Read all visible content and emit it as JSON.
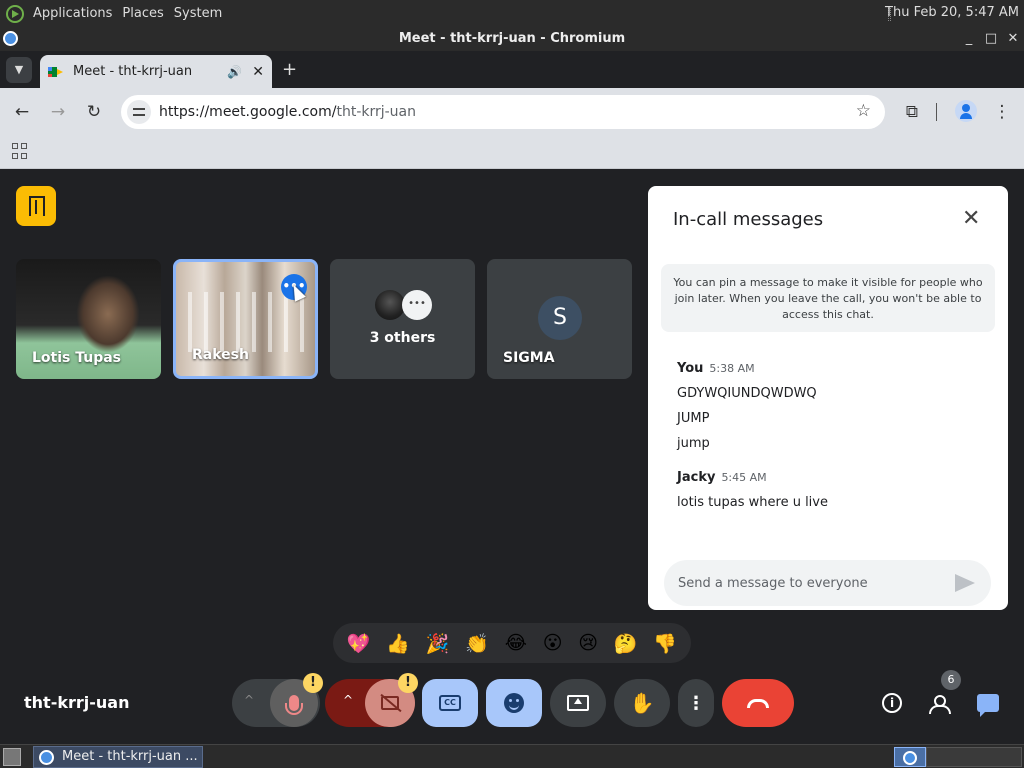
{
  "system_panel": {
    "menus": [
      "Applications",
      "Places",
      "System"
    ],
    "clock": "Thu Feb 20,  5:47 AM"
  },
  "window": {
    "title": "Meet - tht-krrj-uan - Chromium",
    "controls": [
      "_",
      "□",
      "✕"
    ]
  },
  "browser": {
    "tab_title": "Meet - tht-krrj-uan",
    "url_host": "https://meet.google.com/",
    "url_path": "tht-krrj-uan",
    "icons": [
      "back-icon",
      "forward-icon",
      "reload-icon",
      "star-icon",
      "extensions-icon",
      "profile-icon",
      "menu-icon",
      "apps-icon"
    ]
  },
  "meet": {
    "meeting_code": "tht-krrj-uan",
    "tiles": [
      {
        "name": "Lotis Tupas"
      },
      {
        "name": "Rakesh"
      },
      {
        "name": "3 others",
        "avatar_text": "•••"
      },
      {
        "name": "SIGMA",
        "avatar": "S"
      }
    ],
    "reactions": [
      "💖",
      "👍",
      "🎉",
      "👏",
      "😂",
      "😮",
      "😢",
      "🤔",
      "👎"
    ],
    "people_count": "6",
    "warning_glyph": "!",
    "cc_label": "CC"
  },
  "chat": {
    "title": "In-call messages",
    "notice": "You can pin a message to make it visible for people who join later. When you leave the call, you won't be able to access this chat.",
    "messages": [
      {
        "sender": "You",
        "time": "5:38 AM",
        "lines": [
          "GDYWQIUNDQWDWQ",
          "JUMP",
          "jump"
        ]
      },
      {
        "sender": "Jacky",
        "time": "5:45 AM",
        "lines": [
          "lotis tupas where u live"
        ]
      }
    ],
    "input_placeholder": "Send a message to everyone"
  },
  "taskbar": {
    "task_label": "Meet - tht-krrj-uan ..."
  },
  "colors": {
    "meet_bg": "#202124",
    "leave_red": "#ea4335",
    "accent_blue": "#a8c7fa",
    "badge_yellow": "#fbbc04"
  }
}
